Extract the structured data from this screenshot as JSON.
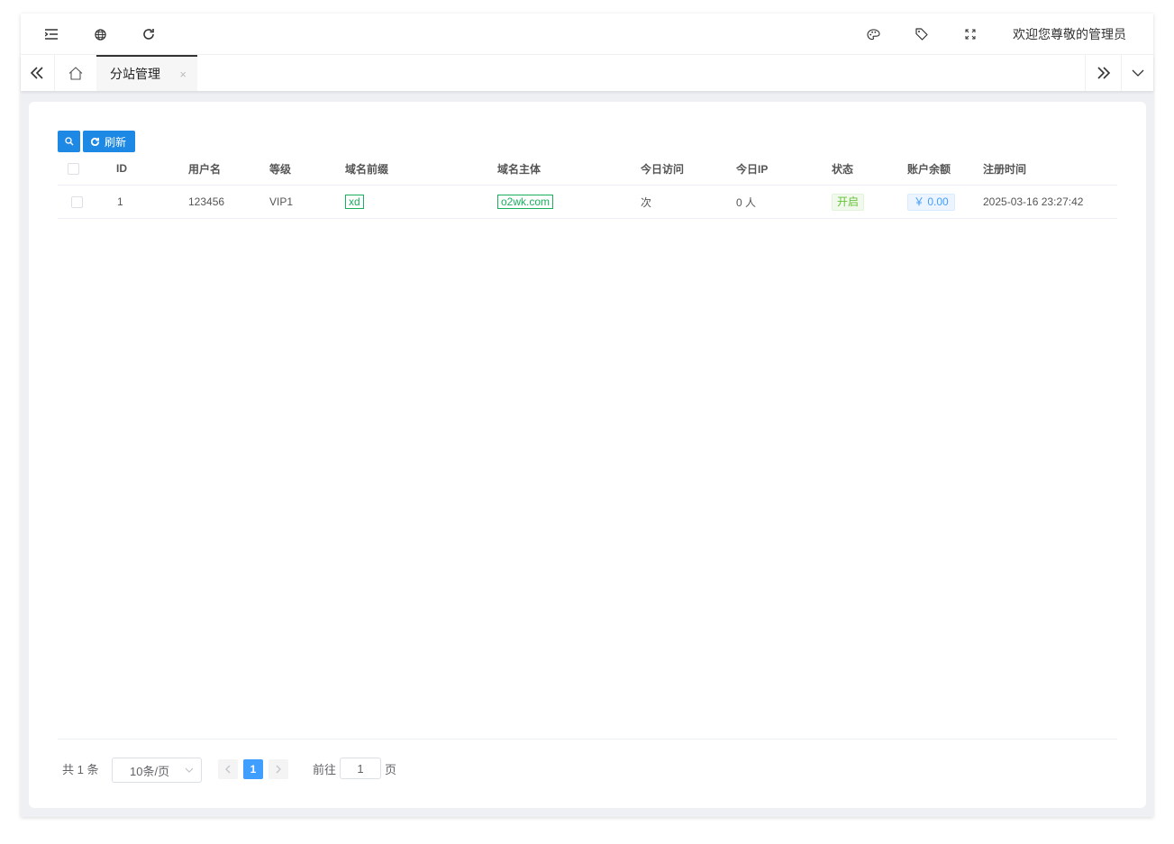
{
  "header": {
    "welcome_text": "欢迎您尊敬的管理员",
    "icons": [
      "menu-fold-icon",
      "globe-icon",
      "refresh-icon",
      "palette-icon",
      "tag-icon",
      "fullscreen-icon"
    ]
  },
  "tabs": {
    "active_label": "分站管理",
    "close_symbol": "×"
  },
  "toolbar": {
    "refresh_label": "刷新"
  },
  "table": {
    "columns": [
      "ID",
      "用户名",
      "等级",
      "域名前缀",
      "域名主体",
      "今日访问",
      "今日IP",
      "状态",
      "账户余额",
      "注册时间"
    ],
    "rows": [
      {
        "id": "1",
        "username": "123456",
        "level": "VIP1",
        "domain_prefix": "xd",
        "domain_main": "o2wk.com",
        "today_visits": "次",
        "today_ip": "0 人",
        "status": "开启",
        "balance": "￥ 0.00",
        "register_time": "2025-03-16 23:27:42"
      }
    ]
  },
  "pagination": {
    "total_text": "共 1 条",
    "page_size": "10条/页",
    "current_page": "1",
    "goto_prefix": "前往",
    "goto_value": "1",
    "goto_suffix": "页"
  },
  "colors": {
    "primary": "#1e88e5",
    "tag_green": "#1aaf5d",
    "status_green": "#67c23a",
    "money_blue": "#409eff"
  }
}
